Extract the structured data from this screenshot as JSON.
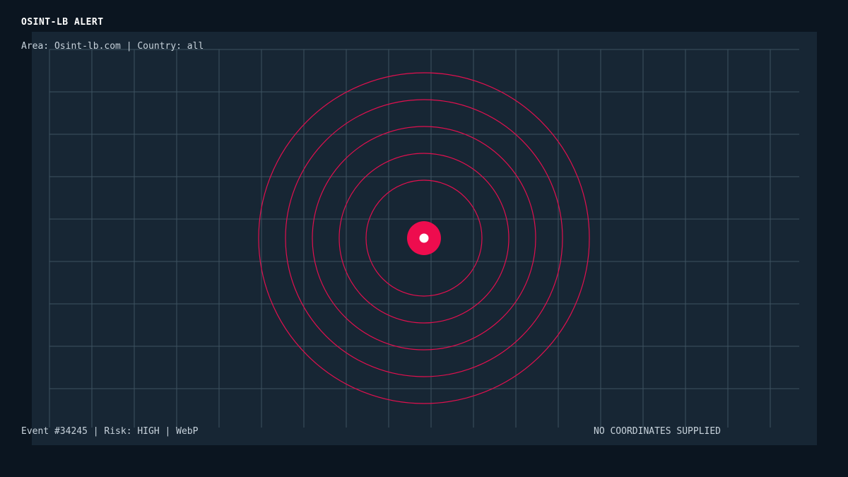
{
  "header": {
    "title": "OSINT-LB ALERT",
    "subtitle": "Area: Osint-lb.com | Country: all"
  },
  "footer": {
    "event_info": "Event #34245 | Risk: HIGH | WebP",
    "coords_status": "NO COORDINATES SUPPLIED"
  },
  "colors": {
    "page_background": "#0b1520",
    "panel_background": "#172634",
    "grid_line": "#3d5260",
    "ring": "#e0104f",
    "marker": "#ee0c4e",
    "marker_center": "#ffffff"
  },
  "radar": {
    "ring_count": 5
  }
}
